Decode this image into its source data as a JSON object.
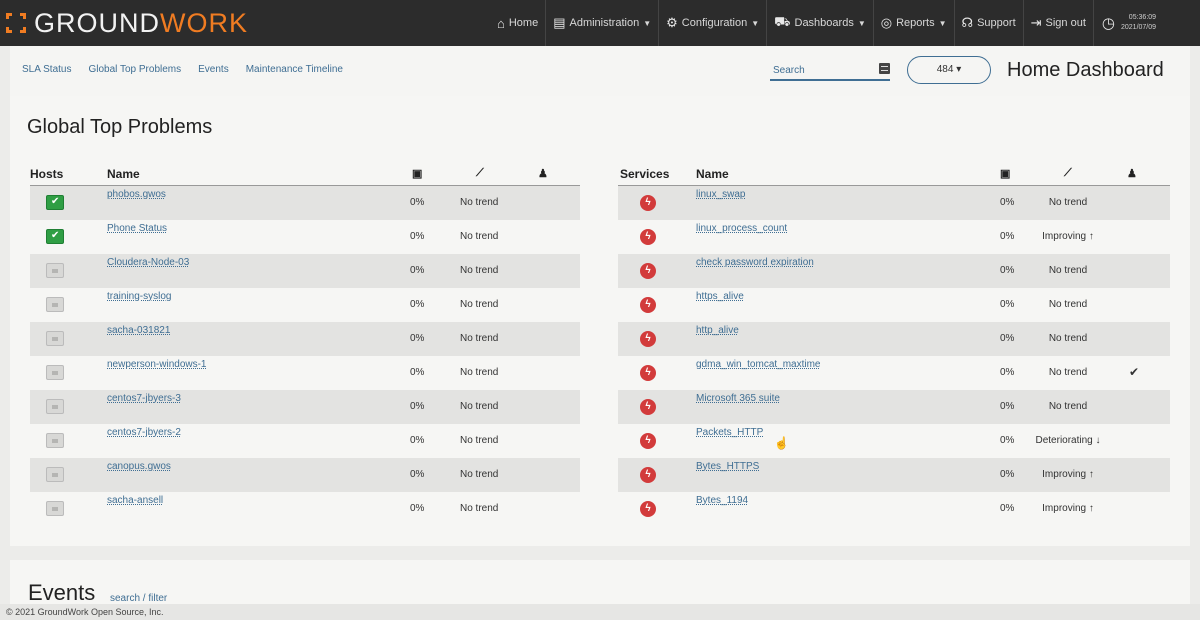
{
  "brand": {
    "part1": "GROUND",
    "part2": "WORK"
  },
  "nav": [
    {
      "icon": "home-icon",
      "glyph": "⌂",
      "label": "Home",
      "caret": false
    },
    {
      "icon": "clipboard-icon",
      "glyph": "▤",
      "label": "Administration",
      "caret": true
    },
    {
      "icon": "gear-icon",
      "glyph": "⚙",
      "label": "Configuration",
      "caret": true
    },
    {
      "icon": "cart-icon",
      "glyph": "⛟",
      "label": "Dashboards",
      "caret": true
    },
    {
      "icon": "reports-icon",
      "glyph": "◎",
      "label": "Reports",
      "caret": true
    },
    {
      "icon": "headset-icon",
      "glyph": "☊",
      "label": "Support",
      "caret": false
    },
    {
      "icon": "sign-out-icon",
      "glyph": "⇥",
      "label": "Sign out",
      "caret": false
    }
  ],
  "clock": {
    "time": "05:36:09",
    "date": "2021/07/09"
  },
  "breadcrumbs": [
    "SLA Status",
    "Global Top Problems",
    "Events",
    "Maintenance Timeline"
  ],
  "search": {
    "placeholder": "Search"
  },
  "count_pill": "484 ▾",
  "page_title": "Home Dashboard",
  "panel_title": "Global Top Problems",
  "hosts_table": {
    "col_status": "Hosts",
    "col_name": "Name",
    "rows": [
      {
        "status": "ok",
        "name": "phobos.gwos",
        "pct": "0%",
        "trend": "No trend",
        "ack": ""
      },
      {
        "status": "ok",
        "name": "Phone Status",
        "pct": "0%",
        "trend": "No trend",
        "ack": ""
      },
      {
        "status": "unknown",
        "name": "Cloudera-Node-03",
        "pct": "0%",
        "trend": "No trend",
        "ack": ""
      },
      {
        "status": "unknown",
        "name": "training-syslog",
        "pct": "0%",
        "trend": "No trend",
        "ack": ""
      },
      {
        "status": "unknown",
        "name": "sacha-031821",
        "pct": "0%",
        "trend": "No trend",
        "ack": ""
      },
      {
        "status": "unknown",
        "name": "newperson-windows-1",
        "pct": "0%",
        "trend": "No trend",
        "ack": ""
      },
      {
        "status": "unknown",
        "name": "centos7-jbyers-3",
        "pct": "0%",
        "trend": "No trend",
        "ack": ""
      },
      {
        "status": "unknown",
        "name": "centos7-jbyers-2",
        "pct": "0%",
        "trend": "No trend",
        "ack": ""
      },
      {
        "status": "unknown",
        "name": "canopus.gwos",
        "pct": "0%",
        "trend": "No trend",
        "ack": ""
      },
      {
        "status": "unknown",
        "name": "sacha-ansell",
        "pct": "0%",
        "trend": "No trend",
        "ack": ""
      }
    ]
  },
  "services_table": {
    "col_status": "Services",
    "col_name": "Name",
    "rows": [
      {
        "name": "linux_swap",
        "pct": "0%",
        "trend": "No trend",
        "ack": ""
      },
      {
        "name": "linux_process_count",
        "pct": "0%",
        "trend": "Improving ↑",
        "ack": ""
      },
      {
        "name": "check password expiration",
        "pct": "0%",
        "trend": "No trend",
        "ack": ""
      },
      {
        "name": "https_alive",
        "pct": "0%",
        "trend": "No trend",
        "ack": ""
      },
      {
        "name": "http_alive",
        "pct": "0%",
        "trend": "No trend",
        "ack": ""
      },
      {
        "name": "gdma_win_tomcat_maxtime",
        "pct": "0%",
        "trend": "No trend",
        "ack": "✔"
      },
      {
        "name": "Microsoft 365 suite",
        "pct": "0%",
        "trend": "No trend",
        "ack": ""
      },
      {
        "name": "Packets_HTTP",
        "pct": "0%",
        "trend": "Deteriorating ↓",
        "ack": ""
      },
      {
        "name": "Bytes_HTTPS",
        "pct": "0%",
        "trend": "Improving ↑",
        "ack": ""
      },
      {
        "name": "Bytes_1194",
        "pct": "0%",
        "trend": "Improving ↑",
        "ack": ""
      }
    ]
  },
  "events": {
    "title": "Events",
    "link": "search / filter"
  },
  "footer": "© 2021 GroundWork Open Source, Inc."
}
